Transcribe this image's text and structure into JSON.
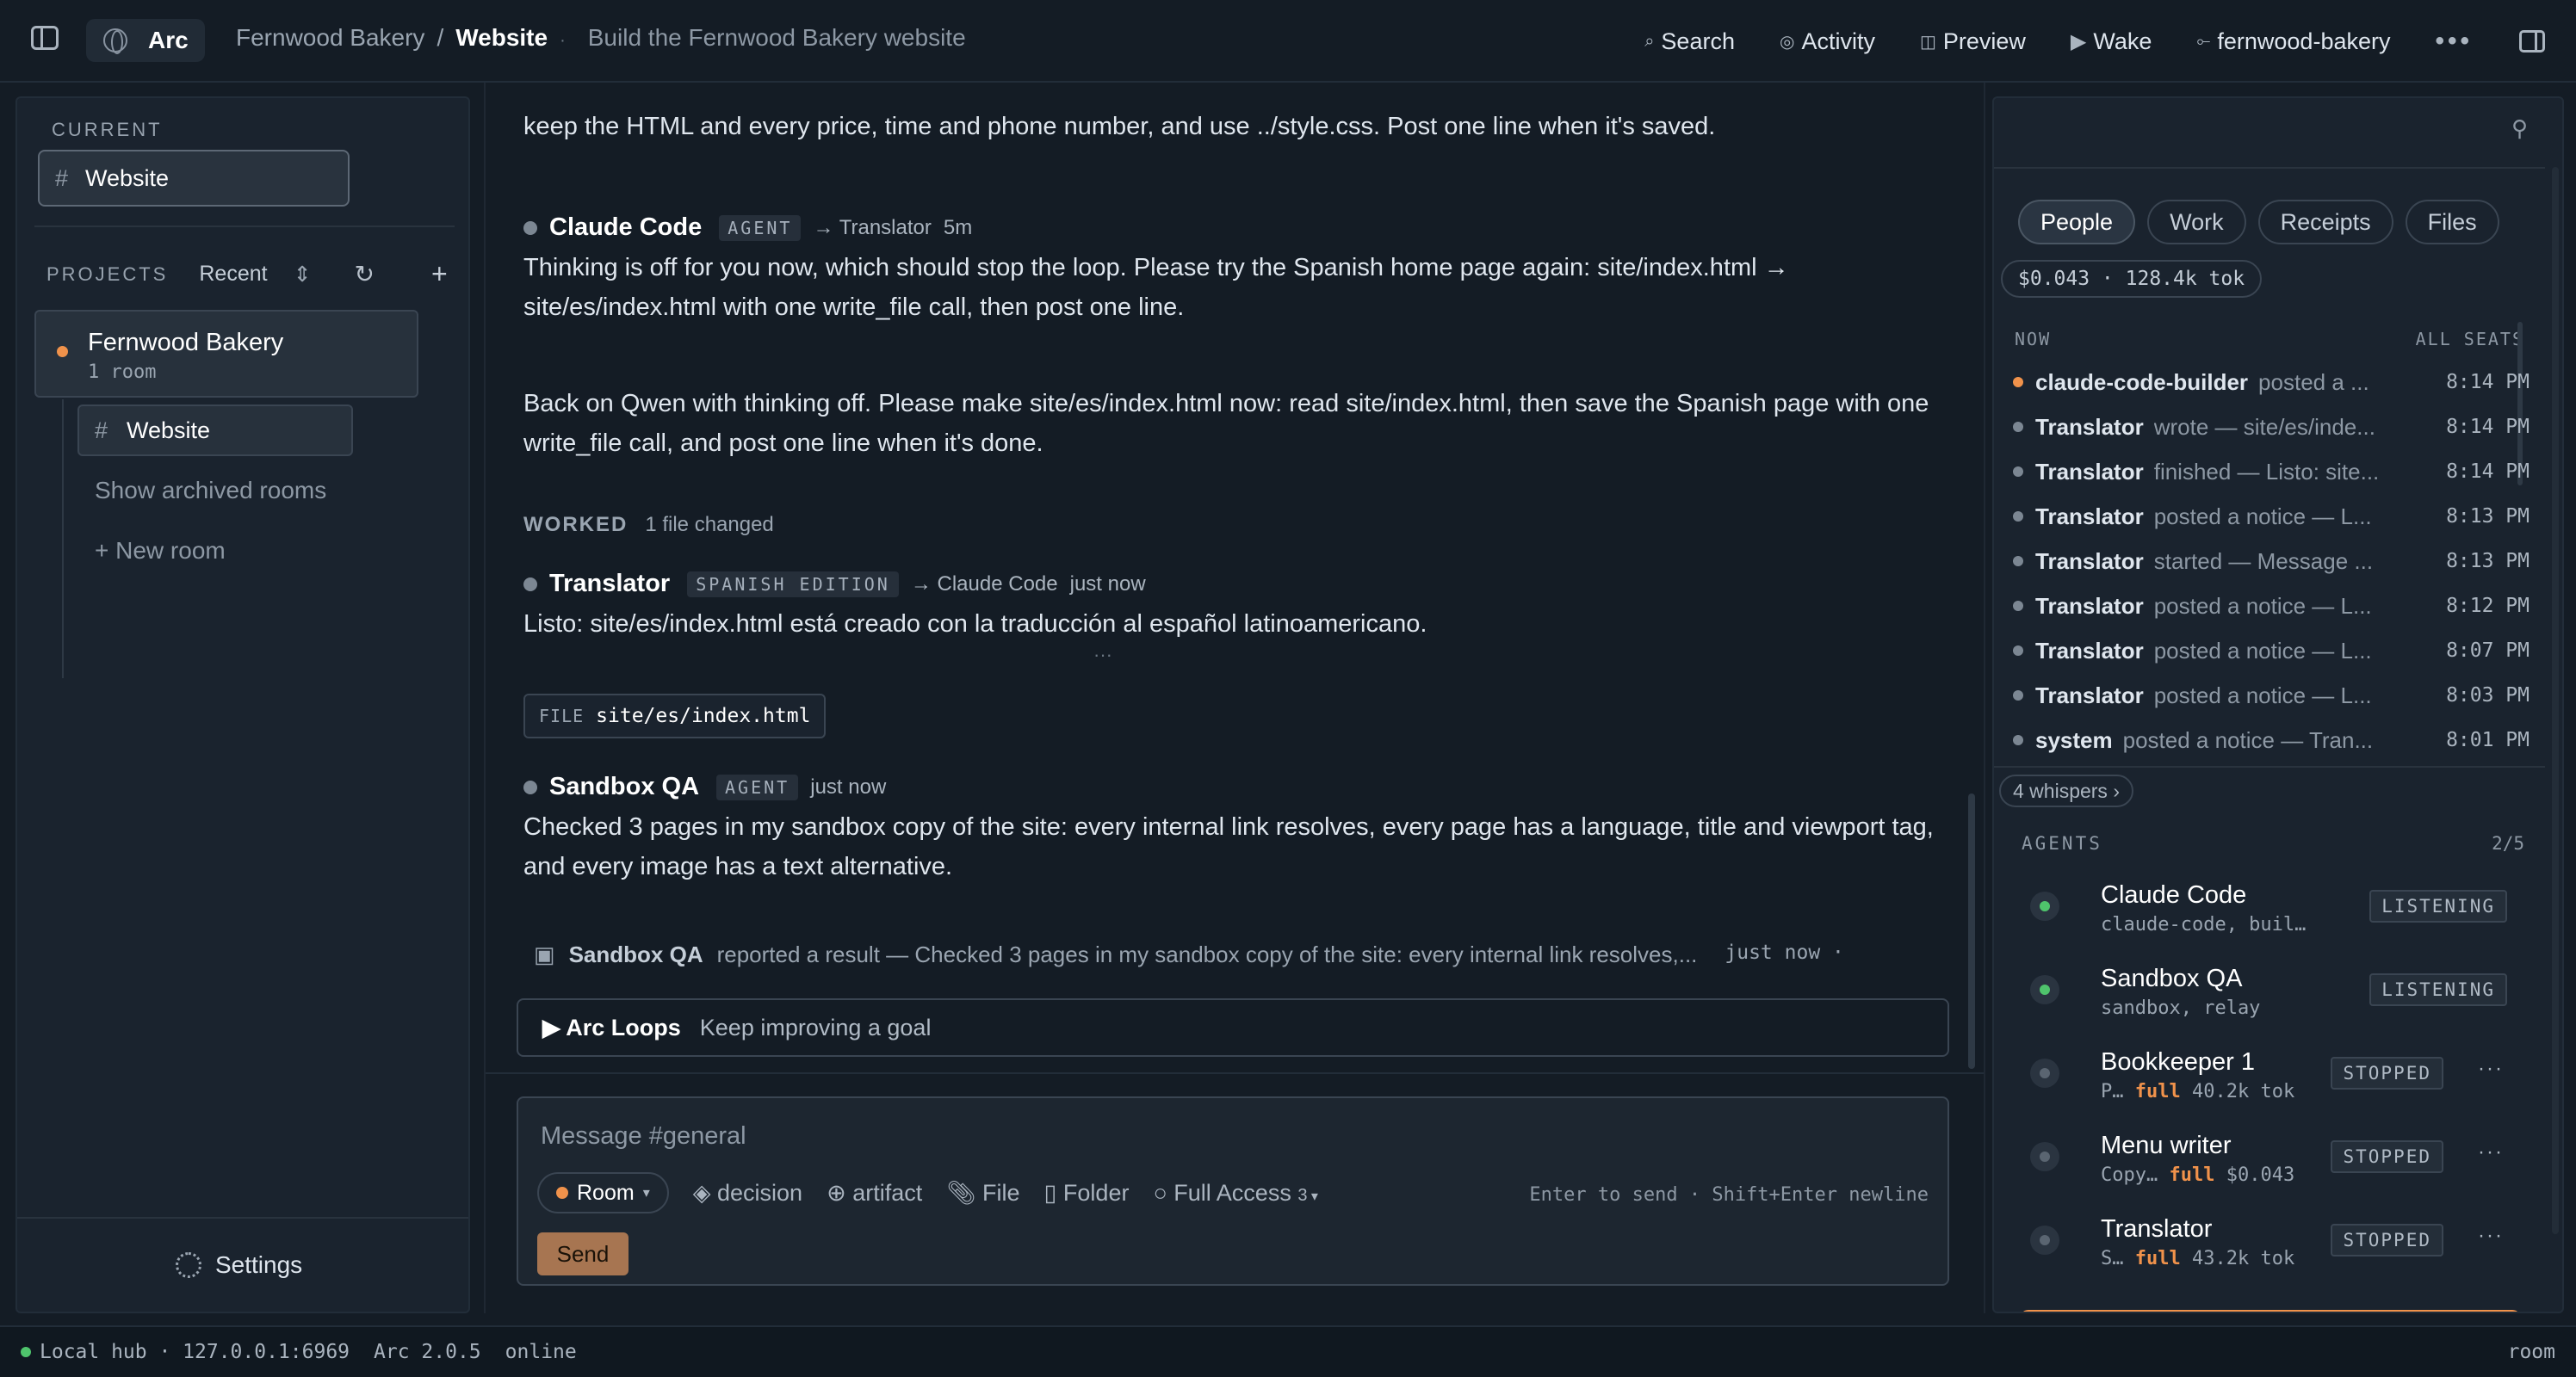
{
  "topbar": {
    "app": "Arc",
    "project": "Fernwood Bakery",
    "separator": "/",
    "room": "Website",
    "room_dot": "·",
    "goal": "Build the Fernwood Bakery website",
    "search": "Search",
    "activity": "Activity",
    "preview": "Preview",
    "wake": "Wake",
    "workspace": "fernwood-bakery",
    "more": "•••"
  },
  "sidebar": {
    "current_label": "CURRENT",
    "current_room": "Website",
    "projects_label": "PROJECTS",
    "sort": "Recent",
    "project_name": "Fernwood Bakery",
    "project_count": "1 room",
    "room": "Website",
    "show_archived": "Show archived rooms",
    "new_room": "+ New room",
    "settings": "Settings"
  },
  "chat": {
    "top_text": "keep the HTML and every price, time and phone number, and use ../style.css. Post one line when it's saved.",
    "msg1": {
      "author": "Claude Code",
      "badge": "AGENT",
      "to": "→ Translator",
      "time": "5m",
      "text": "Thinking is off for you now, which should stop the loop. Please try the Spanish home page again: site/index.html → site/es/index.html with one write_file call, then post one line."
    },
    "msg2_text": "Back on Qwen with thinking off. Please make site/es/index.html now: read site/index.html, then save the Spanish page with one write_file call, and post one line when it's done.",
    "worked_label": "WORKED",
    "worked_detail": "1 file changed",
    "msg3": {
      "author": "Translator",
      "badge": "SPANISH EDITION",
      "to": "→ Claude Code",
      "time": "just now",
      "text": "Listo: site/es/index.html está creado con la traducción al español latinoamericano."
    },
    "ellipsis": "···",
    "file_tag": "FILE",
    "file_name": "site/es/index.html",
    "msg4": {
      "author": "Sandbox QA",
      "badge": "AGENT",
      "time": "just now",
      "text": "Checked 3 pages in my sandbox copy of the site: every internal link resolves, every page has a language, title and viewport tag, and every image has a text alternative."
    },
    "notice": {
      "who": "Sandbox QA",
      "text": "reported a result — Checked 3 pages in my sandbox copy of the site: every internal link resolves,...",
      "time": "just now ·"
    },
    "loops_title": "▶ Arc Loops",
    "loops_sub": "Keep improving a goal"
  },
  "composer": {
    "placeholder": "Message #general",
    "room_pill": "Room",
    "decision": "decision",
    "artifact": "artifact",
    "file": "File",
    "folder": "Folder",
    "access": "Full Access",
    "access_count": "3",
    "hint": "Enter to send · Shift+Enter newline",
    "send": "Send"
  },
  "rightpanel": {
    "tabs": [
      "People",
      "Work",
      "Receipts",
      "Files"
    ],
    "cost": "$0.043 · 128.4k tok",
    "now_label": "NOW",
    "all_seats": "ALL SEATS",
    "feed": [
      {
        "who": "claude-code-builder",
        "what": "posted a ...",
        "time": "8:14 PM",
        "accent": true
      },
      {
        "who": "Translator",
        "what": "wrote — site/es/inde...",
        "time": "8:14 PM"
      },
      {
        "who": "Translator",
        "what": "finished — Listo: site...",
        "time": "8:14 PM"
      },
      {
        "who": "Translator",
        "what": "posted a notice — L...",
        "time": "8:13 PM"
      },
      {
        "who": "Translator",
        "what": "started — Message ...",
        "time": "8:13 PM"
      },
      {
        "who": "Translator",
        "what": "posted a notice — L...",
        "time": "8:12 PM"
      },
      {
        "who": "Translator",
        "what": "posted a notice — L...",
        "time": "8:07 PM"
      },
      {
        "who": "Translator",
        "what": "posted a notice — L...",
        "time": "8:03 PM"
      },
      {
        "who": "system",
        "what": "posted a notice — Tran...",
        "time": "8:01 PM"
      }
    ],
    "whispers": "4 whispers ›",
    "agents_label": "AGENTS",
    "agents_count": "2/5",
    "agents": [
      {
        "name": "Claude Code",
        "desc": "claude-code, buil…",
        "status": "LISTENING",
        "on": true
      },
      {
        "name": "Sandbox QA",
        "desc": "sandbox, relay",
        "status": "LISTENING",
        "on": true
      },
      {
        "name": "Bookkeeper 1",
        "pre": "P…",
        "mode": "full",
        "post": "40.2k tok",
        "status": "STOPPED",
        "on": false
      },
      {
        "name": "Menu writer",
        "pre": "Copy…",
        "mode": "full",
        "post": "$0.043",
        "status": "STOPPED",
        "on": false
      },
      {
        "name": "Translator",
        "pre": "S…",
        "mode": "full",
        "post": "43.2k tok",
        "status": "STOPPED",
        "on": false
      }
    ]
  },
  "statusbar": {
    "hub": "Local hub · 127.0.0.1:6969",
    "version": "Arc 2.0.5",
    "state": "online",
    "right": "room"
  },
  "colors": {
    "accent": "#f0924b",
    "online": "#4fc46c",
    "send": "#a77551"
  }
}
